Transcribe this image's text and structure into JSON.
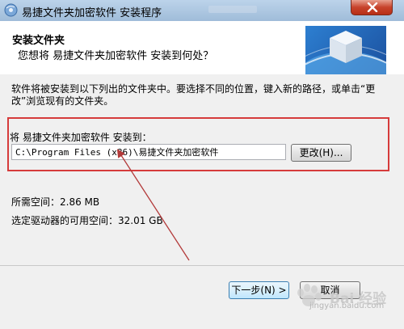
{
  "window": {
    "title": "易捷文件夹加密软件 安装程序",
    "icon": "installer-disc-icon"
  },
  "header": {
    "title": "安装文件夹",
    "subtitle": "您想将 易捷文件夹加密软件 安装到何处？",
    "graphic": "globe-box-graphic"
  },
  "body": {
    "description": "软件将被安装到以下列出的文件夹中。要选择不同的位置，键入新的路径，或单击“更改”浏览现有的文件夹。",
    "install_label": "将 易捷文件夹加密软件 安装到：",
    "install_path": "C:\\Program Files (x86)\\易捷文件夹加密软件",
    "browse_label": "更改(H)...",
    "space_required": "所需空间：2.86 MB",
    "space_available": "选定驱动器的可用空间：32.01 GB"
  },
  "footer": {
    "next_label": "下一步(N) >",
    "cancel_label": "取消"
  },
  "watermark": {
    "brand": "Bai 经验",
    "url": "jingyan.baidu.com"
  },
  "colors": {
    "highlight_box": "#d63b3b",
    "annotation_arrow": "#b33a3a",
    "titlebar": "#b4cde6",
    "close_button": "#c7432b"
  }
}
